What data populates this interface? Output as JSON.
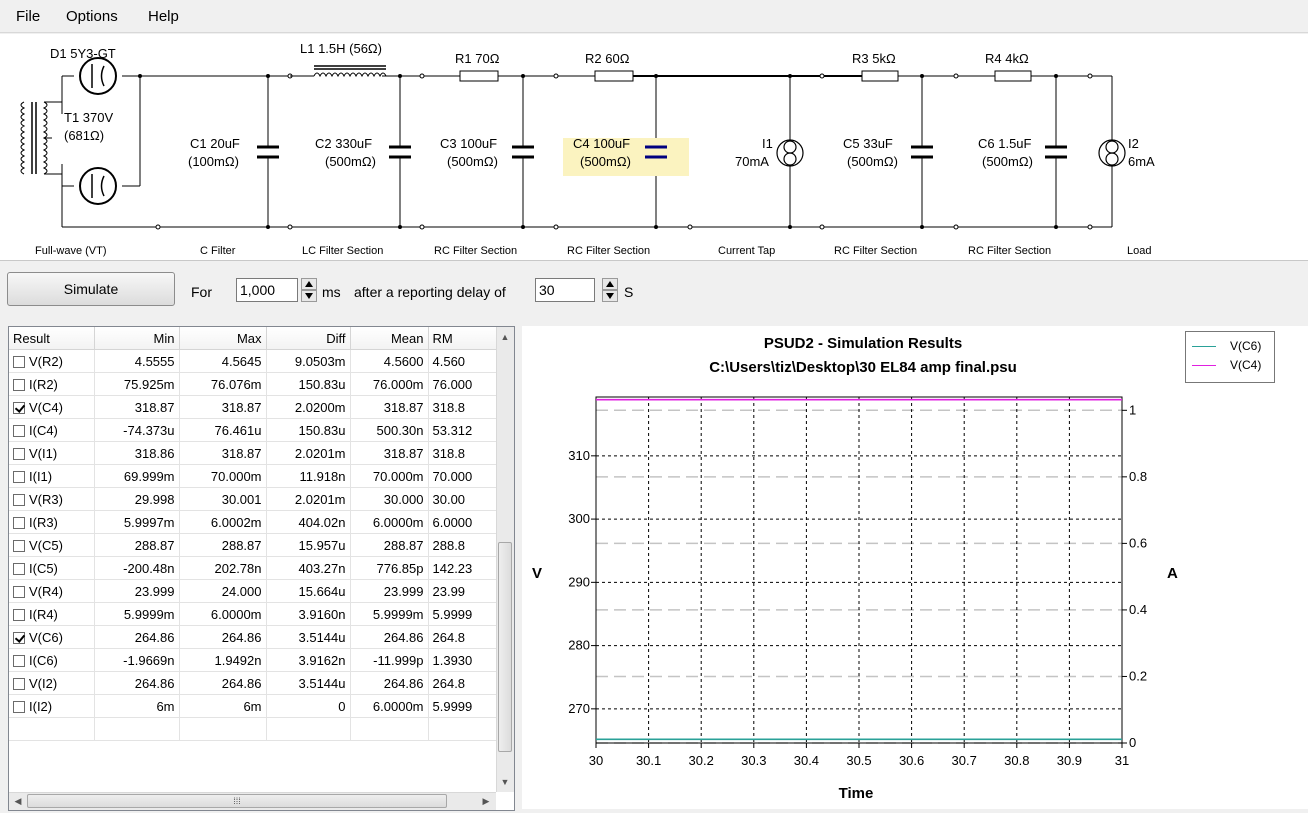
{
  "menu": [
    "File",
    "Options",
    "Help"
  ],
  "schematic": {
    "rectifier": {
      "label": "D1 5Y3-GT",
      "section": "Full-wave (VT)"
    },
    "transformer": {
      "label1": "T1 370V",
      "label2": "(681Ω)"
    },
    "c1": {
      "label1": "C1 20uF",
      "label2": "(100mΩ)",
      "section": "C Filter"
    },
    "l1": {
      "label": "L1 1.5H (56Ω)"
    },
    "c2": {
      "label1": "C2 330uF",
      "label2": "(500mΩ)",
      "section": "LC Filter Section"
    },
    "r1": {
      "label": "R1 70Ω"
    },
    "c3": {
      "label1": "C3 100uF",
      "label2": "(500mΩ)",
      "section": "RC Filter Section"
    },
    "r2": {
      "label": "R2 60Ω"
    },
    "c4": {
      "label1": "C4 100uF",
      "label2": "(500mΩ)",
      "section": "RC Filter Section"
    },
    "i1": {
      "label1": "I1",
      "label2": "70mA",
      "section": "Current Tap"
    },
    "r3": {
      "label": "R3 5kΩ"
    },
    "c5": {
      "label1": "C5 33uF",
      "label2": "(500mΩ)",
      "section": "RC Filter Section"
    },
    "r4": {
      "label": "R4 4kΩ"
    },
    "c6": {
      "label1": "C6 1.5uF",
      "label2": "(500mΩ)",
      "section": "RC Filter Section"
    },
    "i2": {
      "label1": "I2",
      "label2": "6mA",
      "section": "Load"
    }
  },
  "toolbar": {
    "simulate_label": "Simulate",
    "for_label": "For",
    "duration_value": "1,000",
    "ms_label": "ms",
    "delay_label": "after a reporting delay of",
    "delay_value": "30",
    "s_label": "S"
  },
  "results": {
    "headers": [
      "Result",
      "Min",
      "Max",
      "Diff",
      "Mean",
      "RM"
    ],
    "rows": [
      {
        "name": "V(R2)",
        "checked": false,
        "min": "4.5555",
        "max": "4.5645",
        "diff": "9.0503m",
        "mean": "4.5600",
        "rms": "4.560"
      },
      {
        "name": "I(R2)",
        "checked": false,
        "min": "75.925m",
        "max": "76.076m",
        "diff": "150.83u",
        "mean": "76.000m",
        "rms": "76.000"
      },
      {
        "name": "V(C4)",
        "checked": true,
        "min": "318.87",
        "max": "318.87",
        "diff": "2.0200m",
        "mean": "318.87",
        "rms": "318.8"
      },
      {
        "name": "I(C4)",
        "checked": false,
        "min": "-74.373u",
        "max": "76.461u",
        "diff": "150.83u",
        "mean": "500.30n",
        "rms": "53.312"
      },
      {
        "name": "V(I1)",
        "checked": false,
        "min": "318.86",
        "max": "318.87",
        "diff": "2.0201m",
        "mean": "318.87",
        "rms": "318.8"
      },
      {
        "name": "I(I1)",
        "checked": false,
        "min": "69.999m",
        "max": "70.000m",
        "diff": "11.918n",
        "mean": "70.000m",
        "rms": "70.000"
      },
      {
        "name": "V(R3)",
        "checked": false,
        "min": "29.998",
        "max": "30.001",
        "diff": "2.0201m",
        "mean": "30.000",
        "rms": "30.00"
      },
      {
        "name": "I(R3)",
        "checked": false,
        "min": "5.9997m",
        "max": "6.0002m",
        "diff": "404.02n",
        "mean": "6.0000m",
        "rms": "6.0000"
      },
      {
        "name": "V(C5)",
        "checked": false,
        "min": "288.87",
        "max": "288.87",
        "diff": "15.957u",
        "mean": "288.87",
        "rms": "288.8"
      },
      {
        "name": "I(C5)",
        "checked": false,
        "min": "-200.48n",
        "max": "202.78n",
        "diff": "403.27n",
        "mean": "776.85p",
        "rms": "142.23"
      },
      {
        "name": "V(R4)",
        "checked": false,
        "min": "23.999",
        "max": "24.000",
        "diff": "15.664u",
        "mean": "23.999",
        "rms": "23.99"
      },
      {
        "name": "I(R4)",
        "checked": false,
        "min": "5.9999m",
        "max": "6.0000m",
        "diff": "3.9160n",
        "mean": "5.9999m",
        "rms": "5.9999"
      },
      {
        "name": "V(C6)",
        "checked": true,
        "min": "264.86",
        "max": "264.86",
        "diff": "3.5144u",
        "mean": "264.86",
        "rms": "264.8"
      },
      {
        "name": "I(C6)",
        "checked": false,
        "min": "-1.9669n",
        "max": "1.9492n",
        "diff": "3.9162n",
        "mean": "-11.999p",
        "rms": "1.3930"
      },
      {
        "name": "V(I2)",
        "checked": false,
        "min": "264.86",
        "max": "264.86",
        "diff": "3.5144u",
        "mean": "264.86",
        "rms": "264.8"
      },
      {
        "name": "I(I2)",
        "checked": false,
        "min": "6m",
        "max": "6m",
        "diff": "0",
        "mean": "6.0000m",
        "rms": "5.9999"
      }
    ]
  },
  "chart_data": {
    "type": "line",
    "title": "PSUD2 - Simulation Results",
    "subtitle": "C:\\Users\\tiz\\Desktop\\30 EL84 amp final.psu",
    "xlabel": "Time",
    "ylabel_left": "V",
    "ylabel_right": "A",
    "xlim": [
      30,
      31
    ],
    "ylim_left": [
      264.6,
      319.3
    ],
    "ylim_right": [
      0,
      1.04
    ],
    "x_ticks": [
      "30",
      "30.1",
      "30.2",
      "30.3",
      "30.4",
      "30.5",
      "30.6",
      "30.7",
      "30.8",
      "30.9",
      "31"
    ],
    "y_ticks_left": [
      270,
      280,
      290,
      300,
      310
    ],
    "y_ticks_right": [
      "0",
      "0.2",
      "0.4",
      "0.6",
      "0.8",
      "1"
    ],
    "grid": true,
    "legend_position": "top-right",
    "series": [
      {
        "name": "V(C6)",
        "axis": "left",
        "color": "#2aa198",
        "x": [
          30,
          31
        ],
        "values": [
          264.86,
          264.86
        ]
      },
      {
        "name": "V(C4)",
        "axis": "left",
        "color": "#e020e0",
        "x": [
          30,
          31
        ],
        "values": [
          318.87,
          318.87
        ]
      }
    ]
  }
}
